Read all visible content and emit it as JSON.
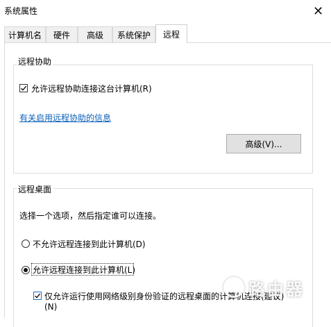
{
  "window": {
    "title": "系统属性",
    "close_glyph": "✕"
  },
  "tabs": [
    {
      "label": "计算机名"
    },
    {
      "label": "硬件"
    },
    {
      "label": "高级"
    },
    {
      "label": "系统保护"
    },
    {
      "label": "远程"
    }
  ],
  "remote_assistance": {
    "group_label": "远程协助",
    "allow_checkbox_label": "允许远程协助连接这台计算机(R)",
    "allow_checked": true,
    "info_link": "有关启用远程协助的信息",
    "advanced_button": "高级(V)..."
  },
  "remote_desktop": {
    "group_label": "远程桌面",
    "instruction": "选择一个选项，然后指定谁可以连接。",
    "option_disallow": "不允许远程连接到此计算机(D)",
    "option_allow": "允许远程连接到此计算机(L)",
    "selected": "allow",
    "nla_label_line1": "仅允许运行使用网络级别身份验证的远程桌面的计算机连接(建议)",
    "nla_label_line2": "(N)",
    "nla_checked": true
  },
  "watermark": {
    "text": "路由器"
  }
}
